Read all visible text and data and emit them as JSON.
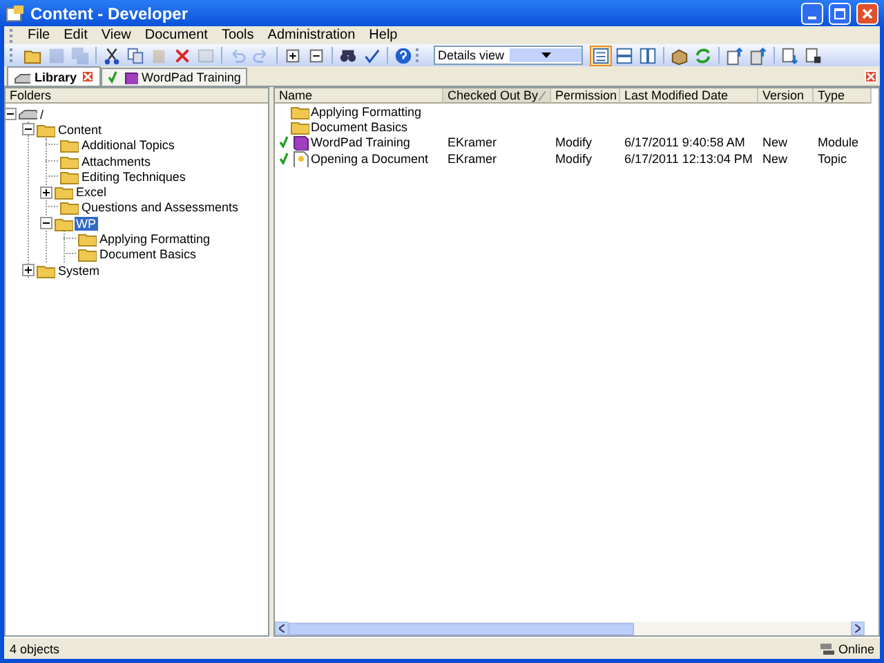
{
  "window": {
    "title": "Content - Developer"
  },
  "menu": [
    "File",
    "Edit",
    "View",
    "Document",
    "Tools",
    "Administration",
    "Help"
  ],
  "toolbar": [
    {
      "kind": "open",
      "disabled": false
    },
    {
      "kind": "save",
      "disabled": true
    },
    {
      "kind": "saveall",
      "disabled": true
    },
    {
      "kind": "sep"
    },
    {
      "kind": "cut",
      "disabled": false
    },
    {
      "kind": "copy",
      "disabled": false
    },
    {
      "kind": "paste",
      "disabled": true
    },
    {
      "kind": "delete",
      "disabled": false
    },
    {
      "kind": "props",
      "disabled": true
    },
    {
      "kind": "sep"
    },
    {
      "kind": "undo",
      "disabled": true
    },
    {
      "kind": "redo",
      "disabled": true
    },
    {
      "kind": "sep"
    },
    {
      "kind": "expand",
      "disabled": false
    },
    {
      "kind": "collapse",
      "disabled": false
    },
    {
      "kind": "sep"
    },
    {
      "kind": "find",
      "disabled": false
    },
    {
      "kind": "spell",
      "disabled": false
    },
    {
      "kind": "sep"
    },
    {
      "kind": "help",
      "disabled": false
    }
  ],
  "view_select": {
    "value": "Details view"
  },
  "view_buttons": [
    {
      "kind": "details",
      "selected": true
    },
    {
      "kind": "horizontal",
      "selected": false
    },
    {
      "kind": "vertical",
      "selected": false
    }
  ],
  "toolbar2": [
    {
      "kind": "publish"
    },
    {
      "kind": "refresh"
    },
    {
      "kind": "sep"
    },
    {
      "kind": "checkin"
    },
    {
      "kind": "checkin2"
    },
    {
      "kind": "sep"
    },
    {
      "kind": "checkout"
    },
    {
      "kind": "lock"
    }
  ],
  "tabs": [
    {
      "label": "Library",
      "kind": "library",
      "selected": true,
      "closable": true,
      "checked_out": false
    },
    {
      "label": "WordPad Training",
      "kind": "module",
      "selected": false,
      "closable": false,
      "checked_out": true
    }
  ],
  "folders": {
    "header": "Folders",
    "tree": [
      {
        "label": "/",
        "kind": "root",
        "expanded": true,
        "selected": false,
        "children": [
          {
            "label": "Content",
            "kind": "folder",
            "expanded": true,
            "selected": false,
            "children": [
              {
                "label": "Additional Topics",
                "kind": "folder",
                "selected": false
              },
              {
                "label": "Attachments",
                "kind": "folder",
                "selected": false
              },
              {
                "label": "Editing Techniques",
                "kind": "folder",
                "selected": false
              },
              {
                "label": "Excel",
                "kind": "folder",
                "expanded": false,
                "selected": false
              },
              {
                "label": "Questions and Assessments",
                "kind": "folder",
                "selected": false
              },
              {
                "label": "WP",
                "kind": "folder",
                "expanded": true,
                "selected": true,
                "children": [
                  {
                    "label": "Applying Formatting",
                    "kind": "folder",
                    "selected": false
                  },
                  {
                    "label": "Document Basics",
                    "kind": "folder",
                    "selected": false
                  }
                ]
              }
            ]
          },
          {
            "label": "System",
            "kind": "folder",
            "expanded": false,
            "selected": false
          }
        ]
      }
    ]
  },
  "table": {
    "columns": [
      {
        "label": "Name",
        "sorted": false
      },
      {
        "label": "Checked Out By",
        "sorted": true
      },
      {
        "label": "Permission",
        "sorted": false
      },
      {
        "label": "Last Modified Date",
        "sorted": false
      },
      {
        "label": "Version",
        "sorted": false
      },
      {
        "label": "Type",
        "sorted": false
      }
    ],
    "rows": [
      {
        "kind": "folder",
        "checked_out": false,
        "cells": [
          "Applying Formatting"
        ]
      },
      {
        "kind": "folder",
        "checked_out": false,
        "cells": [
          "Document Basics"
        ]
      },
      {
        "kind": "module",
        "checked_out": true,
        "cells": [
          "WordPad Training",
          "EKramer",
          "Modify",
          "6/17/2011 9:40:58 AM",
          "New",
          "Module"
        ]
      },
      {
        "kind": "topic",
        "checked_out": true,
        "cells": [
          "Opening a Document",
          "EKramer",
          "Modify",
          "6/17/2011 12:13:04 PM",
          "New",
          "Topic"
        ]
      }
    ]
  },
  "status_bar": {
    "text": "4 objects",
    "connection": "Online"
  }
}
